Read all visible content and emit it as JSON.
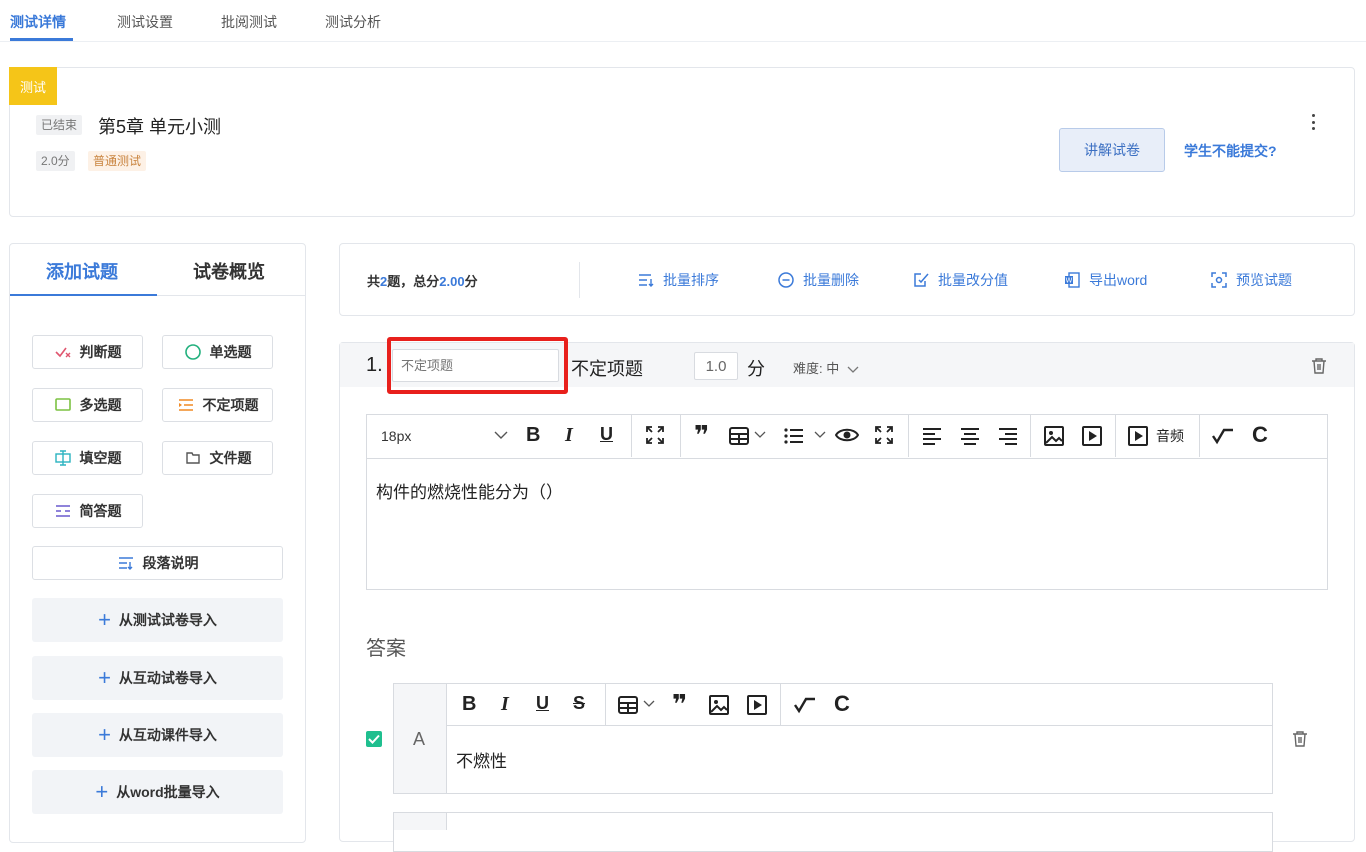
{
  "tabs": [
    {
      "label": "测试详情",
      "active": true
    },
    {
      "label": "测试设置",
      "active": false
    },
    {
      "label": "批阅测试",
      "active": false
    },
    {
      "label": "测试分析",
      "active": false
    }
  ],
  "header": {
    "type_badge": "测试",
    "status": "已结束",
    "title": "第5章 单元小测",
    "score": "2.0分",
    "test_type": "普通测试",
    "explain_button": "讲解试卷",
    "cannot_submit_link": "学生不能提交?"
  },
  "left_panel": {
    "tabs": [
      {
        "label": "添加试题",
        "active": true
      },
      {
        "label": "试卷概览",
        "active": false
      }
    ],
    "question_types": [
      {
        "label": "判断题",
        "icon": "check-cross-icon"
      },
      {
        "label": "单选题",
        "icon": "circle-icon"
      },
      {
        "label": "多选题",
        "icon": "square-icon"
      },
      {
        "label": "不定项题",
        "icon": "list-icon"
      },
      {
        "label": "填空题",
        "icon": "fill-blank-icon"
      },
      {
        "label": "文件题",
        "icon": "file-icon"
      },
      {
        "label": "简答题",
        "icon": "short-answer-icon"
      }
    ],
    "paragraph_button": "段落说明",
    "imports": [
      {
        "label": "从测试试卷导入"
      },
      {
        "label": "从互动试卷导入"
      },
      {
        "label": "从互动课件导入"
      },
      {
        "label": "从word批量导入"
      }
    ]
  },
  "toolbar": {
    "summary_prefix": "共",
    "count": "2",
    "summary_mid": "题，总分",
    "total": "2.00",
    "summary_suffix": "分",
    "actions": [
      {
        "label": "批量排序",
        "icon": "sort-icon"
      },
      {
        "label": "批量删除",
        "icon": "minus-circle-icon"
      },
      {
        "label": "批量改分值",
        "icon": "edit-icon"
      },
      {
        "label": "导出word",
        "icon": "word-icon"
      },
      {
        "label": "预览试题",
        "icon": "preview-icon"
      }
    ]
  },
  "question": {
    "number": "1.",
    "type_input_placeholder": "不定项题",
    "type_label": "不定项题",
    "score_value": "1.0",
    "score_unit": "分",
    "difficulty_label": "难度:",
    "difficulty_value": "中",
    "font_size": "18px",
    "audio_label": "音频",
    "content": "构件的燃烧性能分为（）",
    "answer_heading": "答案",
    "options": [
      {
        "letter": "A",
        "text": "不燃性",
        "checked": true
      }
    ]
  },
  "colors": {
    "accent": "#3b7ad9",
    "badge_yellow": "#f5c518",
    "highlight_red": "#e8201c",
    "check_green": "#1fbf8f"
  }
}
